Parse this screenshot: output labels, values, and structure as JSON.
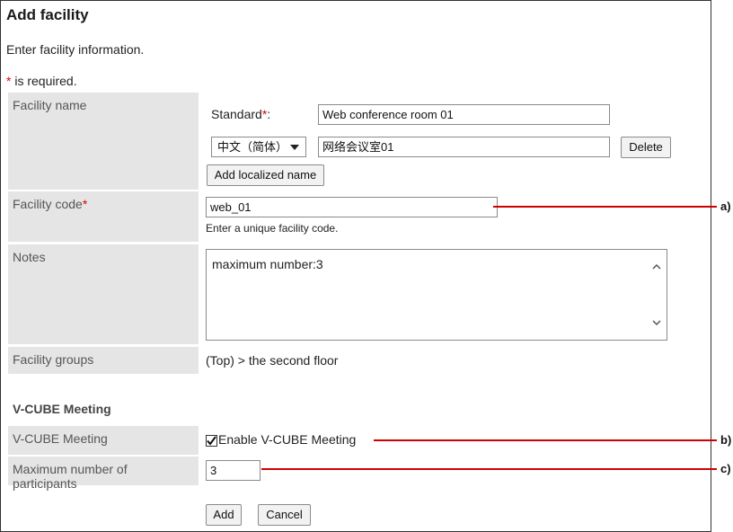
{
  "page": {
    "title": "Add facility",
    "intro": "Enter facility information.",
    "required_mark": "*",
    "required_note": " is required."
  },
  "fields": {
    "facility_name": {
      "label": "Facility name",
      "standard_label": "Standard",
      "standard_suffix": ":",
      "standard_value": "Web conference room 01",
      "locale_selected": "中文（简体）",
      "localized_value": "网络会议室01",
      "delete_label": "Delete",
      "add_localized_label": "Add localized name"
    },
    "facility_code": {
      "label": "Facility code",
      "value": "web_01",
      "hint": "Enter a unique facility code."
    },
    "notes": {
      "label": "Notes",
      "value": "maximum number:3"
    },
    "facility_groups": {
      "label": "Facility groups",
      "value": "(Top) > the second floor"
    }
  },
  "vcube": {
    "section_title": "V-CUBE Meeting",
    "meeting_label": "V-CUBE Meeting",
    "enable_label": "Enable V-CUBE Meeting",
    "enable_checked": true,
    "max_participants_label": "Maximum number of participants",
    "max_participants_value": "3"
  },
  "actions": {
    "add_label": "Add",
    "cancel_label": "Cancel"
  },
  "callouts": {
    "a": "a)",
    "b": "b)",
    "c": "c)",
    "line_color": "#d00000"
  }
}
